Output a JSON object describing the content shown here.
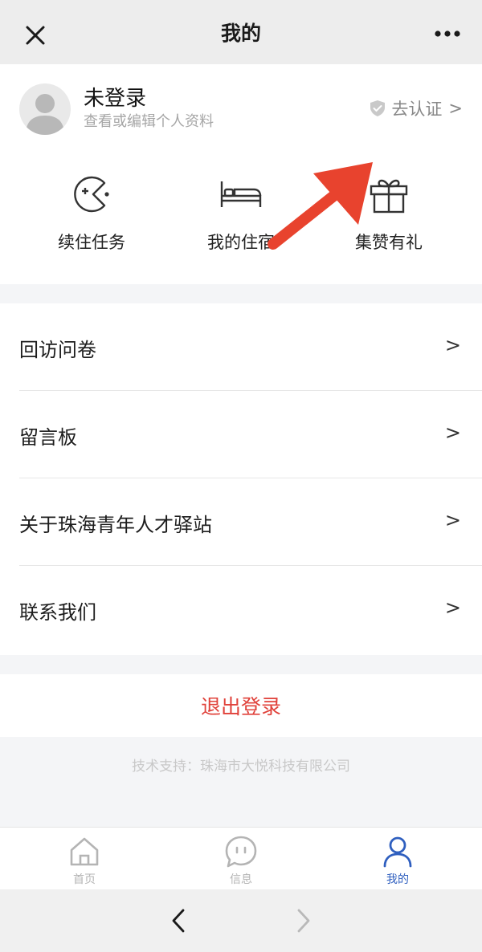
{
  "navbar": {
    "title": "我的",
    "close_icon": "close-icon",
    "more_icon": "more-dots-icon"
  },
  "profile": {
    "name": "未登录",
    "subtitle": "查看或编辑个人资料",
    "verify_label": "去认证",
    "verify_chevron": ">"
  },
  "features": [
    {
      "label": "续住任务",
      "icon": "pacman-game-icon"
    },
    {
      "label": "我的住宿",
      "icon": "bed-icon"
    },
    {
      "label": "集赞有礼",
      "icon": "gift-icon"
    }
  ],
  "menu": [
    {
      "label": "回访问卷",
      "chevron": ">"
    },
    {
      "label": "留言板",
      "chevron": ">"
    },
    {
      "label": "关于珠海青年人才驿站",
      "chevron": ">"
    },
    {
      "label": "联系我们",
      "chevron": ">"
    }
  ],
  "logout_label": "退出登录",
  "support_text": "技术支持：珠海市大悦科技有限公司",
  "tabs": [
    {
      "label": "首页",
      "icon": "home-icon",
      "active": false
    },
    {
      "label": "信息",
      "icon": "chat-icon",
      "active": false
    },
    {
      "label": "我的",
      "icon": "user-icon",
      "active": true
    }
  ],
  "colors": {
    "accent_blue": "#2f5fbf",
    "logout_red": "#e0413a",
    "annotation_red": "#e8432e"
  }
}
